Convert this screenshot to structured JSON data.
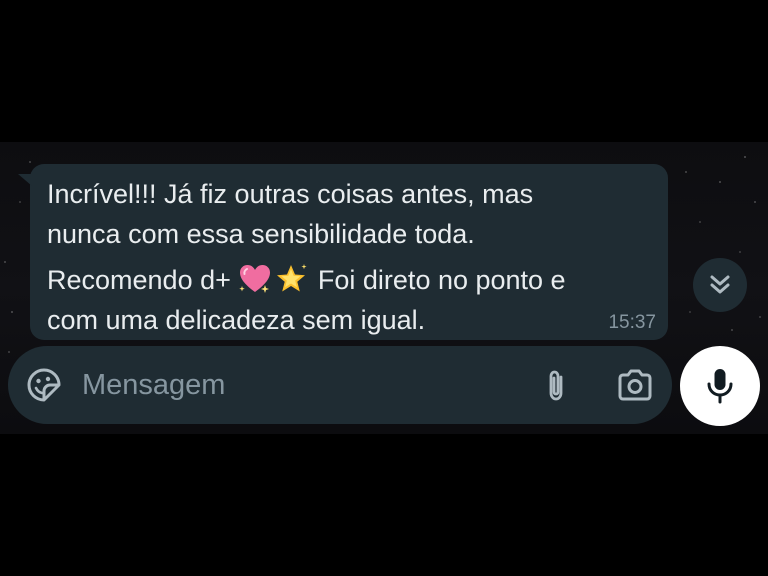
{
  "message": {
    "line1": "Incrível!!! Já fiz outras coisas antes, mas",
    "line2": "nunca com essa sensibilidade toda.",
    "line3_prefix": "Recomendo d+",
    "line3_suffix": "Foi direto no ponto e",
    "line4": "com uma delicadeza sem igual.",
    "time": "15:37",
    "emojis": [
      "sparkling-heart-icon",
      "glowing-star-icon"
    ]
  },
  "composer": {
    "placeholder": "Mensagem"
  },
  "icons": {
    "scroll_down": "double-chevron-down-icon",
    "sticker": "sticker-icon",
    "attach": "paperclip-icon",
    "camera": "camera-icon",
    "mic": "microphone-icon"
  },
  "colors": {
    "bubble": "#1f2c33",
    "text": "#e9edef",
    "muted": "#8696a0",
    "mic_button": "#ffffff"
  }
}
